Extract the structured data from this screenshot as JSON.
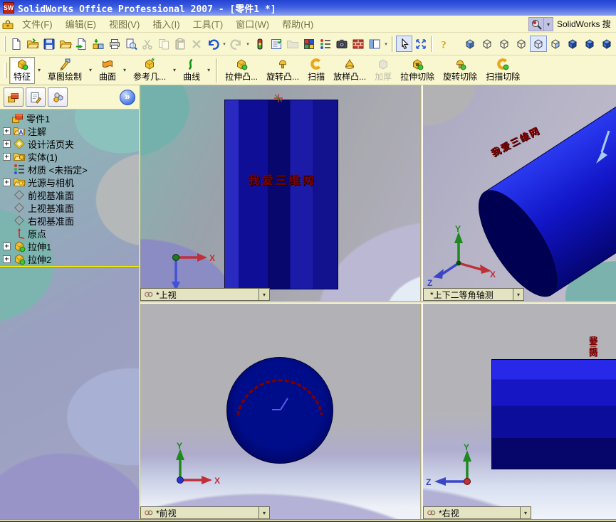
{
  "window": {
    "title": "SolidWorks Office Professional 2007 - [零件1 *]",
    "logo": "SW"
  },
  "ui": {
    "dropdown_glyph": "▾",
    "expand_glyph": "+",
    "overflow_glyph": "»"
  },
  "menu": {
    "items": [
      "文件(F)",
      "编辑(E)",
      "视图(V)",
      "插入(I)",
      "工具(T)",
      "窗口(W)",
      "帮助(H)"
    ],
    "search_label": "SolidWorks 搜"
  },
  "standard_toolbar": {
    "items": [
      {
        "name": "new-button",
        "glyph": "page"
      },
      {
        "name": "open-button",
        "glyph": "folderarrow"
      },
      {
        "name": "save-button",
        "glyph": "disk"
      },
      {
        "name": "open-alt-button",
        "glyph": "folder"
      },
      {
        "name": "make-drawing-button",
        "glyph": "pagearrow"
      },
      {
        "name": "make-assembly-button",
        "glyph": "boxarrow"
      },
      {
        "name": "print-button",
        "glyph": "printer"
      },
      {
        "name": "print-preview-button",
        "glyph": "preview"
      },
      {
        "name": "cut-button",
        "glyph": "scissors",
        "disabled": true
      },
      {
        "name": "copy-button",
        "glyph": "copy",
        "disabled": true
      },
      {
        "name": "paste-button",
        "glyph": "paste",
        "disabled": true
      },
      {
        "name": "delete-button",
        "glyph": "delete",
        "disabled": true
      },
      {
        "name": "undo-button",
        "glyph": "undo",
        "dropdown": true
      },
      {
        "name": "redo-button",
        "glyph": "redo",
        "disabled": true,
        "dropdown": true
      },
      {
        "name": "rebuild-button",
        "glyph": "traffic"
      },
      {
        "name": "options-button",
        "glyph": "checklist"
      },
      {
        "name": "file-properties-button",
        "glyph": "grayfolder",
        "disabled": true
      },
      {
        "name": "edit-color-button",
        "glyph": "palette"
      },
      {
        "name": "display-settings-button",
        "glyph": "dotlist"
      },
      {
        "name": "photo-render-button",
        "glyph": "camera"
      },
      {
        "name": "texture-button",
        "glyph": "bricks"
      },
      {
        "name": "split-view-button",
        "glyph": "pane",
        "dropdown": true
      },
      {
        "sep": true
      },
      {
        "name": "select-button",
        "glyph": "cursor",
        "selected": true
      },
      {
        "name": "zoom-fit-button",
        "glyph": "expand"
      },
      {
        "sep": true
      },
      {
        "name": "help-button",
        "glyph": "help"
      }
    ]
  },
  "view_toolbar": {
    "items": [
      {
        "name": "display-shaded-edges-button",
        "glyph": "cubeshadecorner"
      },
      {
        "name": "display-hidden-lines-visible-button",
        "glyph": "cubewire"
      },
      {
        "name": "display-hidden-lines-removed-button",
        "glyph": "cubewire"
      },
      {
        "name": "display-wireframe-button",
        "glyph": "cubewire"
      },
      {
        "name": "display-current-style-button",
        "glyph": "cubewire",
        "selected": true
      },
      {
        "name": "display-shadow-button",
        "glyph": "cubehalf"
      },
      {
        "name": "view-orientation-1-button",
        "glyph": "cubesolid"
      },
      {
        "name": "view-orientation-2-button",
        "glyph": "cubesolid"
      },
      {
        "name": "view-orientation-3-button",
        "glyph": "cubesolid"
      },
      {
        "name": "clipped-view-button",
        "glyph": "cubesolid",
        "clip": true
      }
    ]
  },
  "features_toolbar": {
    "items": [
      {
        "name": "features-button",
        "label": "特征",
        "glyph": "feature",
        "selected": true,
        "dropdown": true
      },
      {
        "name": "sketch-button",
        "label": "草图绘制",
        "glyph": "sketch",
        "dropdown": true
      },
      {
        "name": "surface-button",
        "label": "曲面",
        "glyph": "surface",
        "dropdown": true
      },
      {
        "name": "reference-geometry-button",
        "label": "参考几...",
        "glyph": "refgeo",
        "dropdown": true
      },
      {
        "name": "curve-button",
        "label": "曲线",
        "glyph": "curve",
        "dropdown": true
      },
      {
        "sep": true
      },
      {
        "name": "extruded-boss-button",
        "label": "拉伸凸...",
        "glyph": "boss"
      },
      {
        "name": "revolved-boss-button",
        "label": "旋转凸...",
        "glyph": "revolve"
      },
      {
        "name": "sweep-button",
        "label": "扫描",
        "glyph": "sweep"
      },
      {
        "name": "loft-button",
        "label": "放样凸...",
        "glyph": "loft"
      },
      {
        "name": "thicken-button",
        "label": "加厚",
        "glyph": "thicken",
        "disabled": true
      },
      {
        "name": "extruded-cut-button",
        "label": "拉伸切除",
        "glyph": "cutext"
      },
      {
        "name": "revolved-cut-button",
        "label": "旋转切除",
        "glyph": "cutrev"
      },
      {
        "name": "swept-cut-button",
        "label": "扫描切除",
        "glyph": "cutsweep"
      }
    ]
  },
  "feature_tree": {
    "tabs": [
      {
        "name": "tab-featuremanager",
        "icon": "part"
      },
      {
        "name": "tab-propertymanager",
        "icon": "tabprop"
      },
      {
        "name": "tab-configurations",
        "icon": "tabconfig"
      }
    ],
    "items": [
      {
        "name": "part-root",
        "label": "零件1",
        "icon": "part",
        "expandable": false
      },
      {
        "name": "annotations",
        "label": "注解",
        "icon": "annotations",
        "expandable": true
      },
      {
        "name": "design-binder",
        "label": "设计活页夹",
        "icon": "binder",
        "expandable": true
      },
      {
        "name": "solid-bodies",
        "label": "实体(1)",
        "icon": "solids",
        "expandable": true
      },
      {
        "name": "material",
        "label": "材质 <未指定>",
        "icon": "material",
        "expandable": false
      },
      {
        "name": "lights-cameras",
        "label": "光源与相机",
        "icon": "lights",
        "expandable": true
      },
      {
        "name": "front-plane",
        "label": "前视基准面",
        "icon": "plane",
        "expandable": false
      },
      {
        "name": "top-plane",
        "label": "上视基准面",
        "icon": "plane",
        "expandable": false
      },
      {
        "name": "right-plane",
        "label": "右视基准面",
        "icon": "plane",
        "expandable": false
      },
      {
        "name": "origin",
        "label": "原点",
        "icon": "origin",
        "expandable": false
      },
      {
        "name": "extrude1",
        "label": "拉伸1",
        "icon": "extrude",
        "expandable": true
      },
      {
        "name": "extrude2",
        "label": "拉伸2",
        "icon": "extrude",
        "expandable": true
      }
    ]
  },
  "viewports": {
    "axis": {
      "x": "X",
      "y": "Y",
      "z": "Z"
    },
    "watermark": "我爱三维网",
    "top_left": {
      "label": "*上视",
      "linked": true
    },
    "top_right": {
      "label": "*上下二等角轴测",
      "linked": false
    },
    "bottom_left": {
      "label": "*前视",
      "linked": true
    },
    "bottom_right": {
      "label": "*右视",
      "linked": true
    }
  },
  "colors": {
    "model_blue": "#0e0e96",
    "watermark_red": "#8b0000",
    "axis_x_red": "#c03038",
    "axis_y_green": "#1e8a1e",
    "axis_z_blue": "#3a46c8",
    "toolbar_bg": "#f9f7cf",
    "titlebar_blue": "#2342d2"
  }
}
